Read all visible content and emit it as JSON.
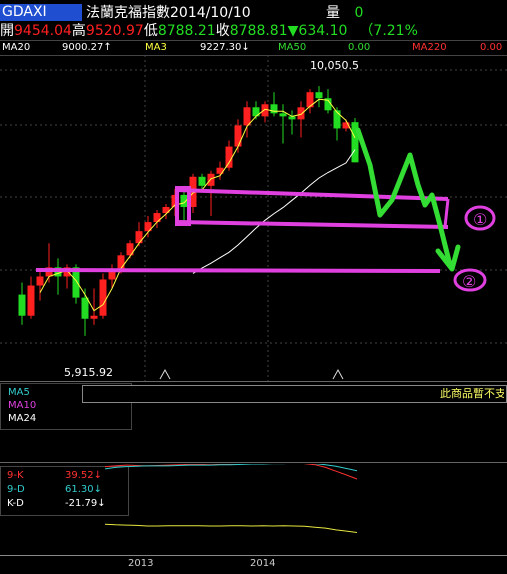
{
  "header": {
    "ticker": "GDAXI",
    "name": "法蘭克福指數",
    "date": "2014/10/10",
    "volume_label": "量",
    "volume_value": "0",
    "open_label": "開",
    "open_value": "9454.04",
    "high_label": "高",
    "high_value": "9520.97",
    "low_label": "低",
    "low_value": "8788.21",
    "close_label": "收",
    "close_value": "8788.81",
    "change_arrow": "▼",
    "change_value": "634.10",
    "change_pct": "（7.21%"
  },
  "ma_bar": {
    "ma20_label": "MA20",
    "ma20_value": "9000.27↑",
    "ma3_label": "MA3",
    "ma3_value": "9227.30↓",
    "ma50_label": "MA50",
    "ma50_value": "0.00",
    "ma220_label": "MA220",
    "ma220_value": "0.00"
  },
  "annotations": {
    "high_mark": "10,050.5",
    "low_mark": "5,915.92",
    "circle1": "①",
    "circle2": "②"
  },
  "lower_panel": {
    "legend": [
      "MA5",
      "MA10",
      "MA24"
    ],
    "message": "此商品暫不支"
  },
  "kd": {
    "k_label": "9-K",
    "k_value": "39.52↓",
    "d_label": "9-D",
    "d_value": "61.30↓",
    "kd_label": "K-D",
    "kd_value": "-21.79↓"
  },
  "colors": {
    "up": "#ff2020",
    "down": "#22dd22",
    "annotation": "#e040e0",
    "arrow": "#33dd33",
    "k_line": "#ff3030",
    "d_line": "#33cccc",
    "kd_line": "#e8e840"
  },
  "chart_data": {
    "type": "candlestick",
    "x_tick_labels": [
      "2013",
      "2014"
    ],
    "y_range": [
      5600,
      10400
    ],
    "candles": [
      {
        "o": 6600,
        "h": 6800,
        "l": 6100,
        "c": 6250
      },
      {
        "o": 6250,
        "h": 6900,
        "l": 6200,
        "c": 6750
      },
      {
        "o": 6750,
        "h": 7000,
        "l": 6500,
        "c": 6900
      },
      {
        "o": 6900,
        "h": 7450,
        "l": 6800,
        "c": 7050
      },
      {
        "o": 7050,
        "h": 7200,
        "l": 6600,
        "c": 6900
      },
      {
        "o": 6900,
        "h": 7100,
        "l": 6700,
        "c": 7050
      },
      {
        "o": 7050,
        "h": 7100,
        "l": 6450,
        "c": 6550
      },
      {
        "o": 6550,
        "h": 6700,
        "l": 5916,
        "c": 6200
      },
      {
        "o": 6200,
        "h": 6700,
        "l": 6100,
        "c": 6250
      },
      {
        "o": 6250,
        "h": 6950,
        "l": 6200,
        "c": 6850
      },
      {
        "o": 6850,
        "h": 7100,
        "l": 6700,
        "c": 7000
      },
      {
        "o": 7000,
        "h": 7300,
        "l": 6950,
        "c": 7250
      },
      {
        "o": 7250,
        "h": 7500,
        "l": 7200,
        "c": 7450
      },
      {
        "o": 7450,
        "h": 7800,
        "l": 7400,
        "c": 7650
      },
      {
        "o": 7650,
        "h": 7900,
        "l": 7550,
        "c": 7800
      },
      {
        "o": 7800,
        "h": 8000,
        "l": 7700,
        "c": 7950
      },
      {
        "o": 7950,
        "h": 8100,
        "l": 7850,
        "c": 8050
      },
      {
        "o": 8050,
        "h": 8350,
        "l": 7900,
        "c": 8250
      },
      {
        "o": 8250,
        "h": 8400,
        "l": 7800,
        "c": 8050
      },
      {
        "o": 8050,
        "h": 8600,
        "l": 7950,
        "c": 8550
      },
      {
        "o": 8550,
        "h": 8600,
        "l": 8350,
        "c": 8400
      },
      {
        "o": 8400,
        "h": 8650,
        "l": 7900,
        "c": 8600
      },
      {
        "o": 8600,
        "h": 8800,
        "l": 8500,
        "c": 8700
      },
      {
        "o": 8700,
        "h": 9150,
        "l": 8650,
        "c": 9050
      },
      {
        "o": 9050,
        "h": 9500,
        "l": 8950,
        "c": 9400
      },
      {
        "o": 9400,
        "h": 9800,
        "l": 9200,
        "c": 9700
      },
      {
        "o": 9700,
        "h": 9800,
        "l": 9500,
        "c": 9550
      },
      {
        "o": 9550,
        "h": 9800,
        "l": 9450,
        "c": 9750
      },
      {
        "o": 9750,
        "h": 9950,
        "l": 9550,
        "c": 9600
      },
      {
        "o": 9600,
        "h": 9750,
        "l": 9100,
        "c": 9550
      },
      {
        "o": 9550,
        "h": 9650,
        "l": 9250,
        "c": 9500
      },
      {
        "o": 9500,
        "h": 9800,
        "l": 9200,
        "c": 9700
      },
      {
        "o": 9700,
        "h": 10000,
        "l": 9600,
        "c": 9950
      },
      {
        "o": 9950,
        "h": 10050,
        "l": 9700,
        "c": 9850
      },
      {
        "o": 9850,
        "h": 10000,
        "l": 9600,
        "c": 9650
      },
      {
        "o": 9650,
        "h": 9700,
        "l": 9150,
        "c": 9350
      },
      {
        "o": 9350,
        "h": 9500,
        "l": 9300,
        "c": 9450
      },
      {
        "o": 9454,
        "h": 9521,
        "l": 8788,
        "c": 8789
      }
    ],
    "moving_averages": [
      {
        "name": "MA3",
        "values": [
          null,
          null,
          6633,
          6900,
          6950,
          7000,
          6833,
          6600,
          6333,
          6433,
          6700,
          7033,
          7233,
          7450,
          7633,
          7800,
          7933,
          8083,
          8117,
          8283,
          8333,
          8517,
          8567,
          8783,
          9050,
          9383,
          9550,
          9667,
          9633,
          9633,
          9550,
          9583,
          9717,
          9833,
          9817,
          9617,
          9483,
          9195
        ]
      },
      {
        "name": "MA20",
        "values": [
          null,
          null,
          null,
          null,
          null,
          null,
          null,
          null,
          null,
          null,
          null,
          null,
          null,
          null,
          null,
          null,
          null,
          null,
          null,
          6950,
          7040,
          7120,
          7210,
          7300,
          7420,
          7560,
          7700,
          7830,
          7940,
          8040,
          8160,
          8280,
          8410,
          8530,
          8620,
          8700,
          8780,
          9000
        ]
      }
    ],
    "kd_values": {
      "K": [
        72,
        74,
        76,
        75,
        74,
        75,
        76,
        77,
        78,
        78,
        77,
        78,
        79,
        80,
        80,
        81,
        81,
        82,
        82,
        80,
        77,
        70,
        60,
        50,
        39.52
      ],
      "D": [
        66,
        70,
        72,
        73,
        74,
        74,
        74,
        75,
        76,
        76,
        76,
        77,
        77,
        78,
        79,
        79,
        80,
        80,
        81,
        81,
        80,
        77,
        73,
        67,
        61.3
      ],
      "K-D": [
        6,
        4,
        3,
        2,
        0,
        0,
        1,
        1,
        1,
        1,
        0,
        0,
        1,
        1,
        0,
        1,
        0,
        1,
        0,
        -1,
        -4,
        -7,
        -13,
        -17,
        -21.79
      ]
    }
  }
}
